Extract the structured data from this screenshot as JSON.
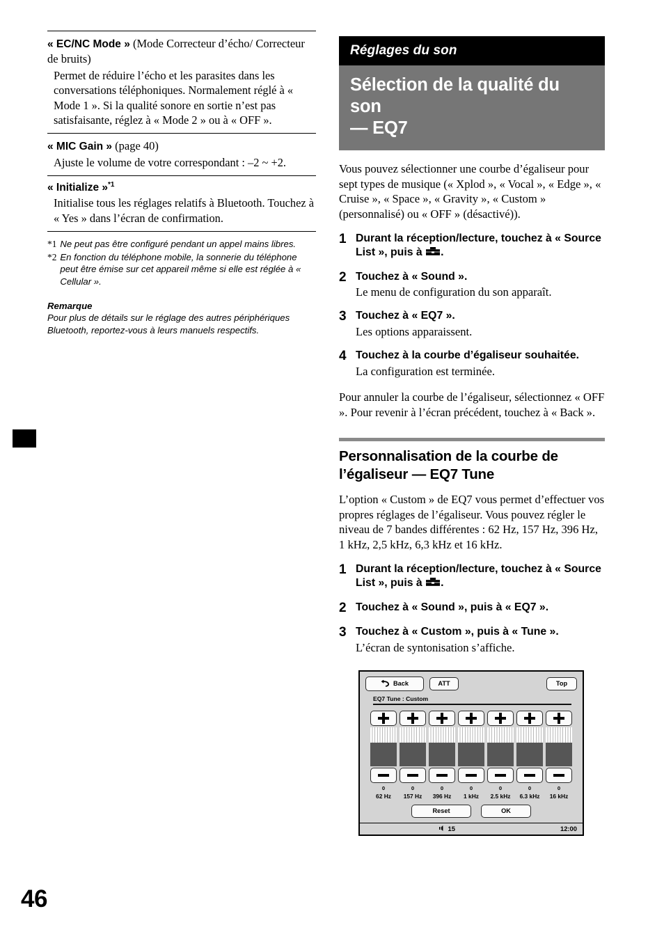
{
  "page": {
    "folio": "46"
  },
  "left_column": {
    "items": [
      {
        "title_bold": "« EC/NC Mode »",
        "title_rest": " (Mode Correcteur d’écho/ Correcteur de bruits)",
        "body": "Permet de réduire l’écho et les parasites dans les conversations téléphoniques. Normalement réglé à « Mode 1 ». Si la qualité sonore en sortie n’est pas satisfaisante, réglez à « Mode 2 » ou à « OFF »."
      },
      {
        "title_bold": "« MIC Gain »",
        "title_rest": " (page 40)",
        "body": "Ajuste le volume de votre correspondant : –2 ~ +2."
      },
      {
        "title_bold": "« Initialize »",
        "title_footnote": "*1",
        "title_rest": "",
        "body": "Initialise tous les réglages relatifs à Bluetooth. Touchez à « Yes » dans l’écran de confirmation."
      }
    ],
    "footnotes": [
      {
        "mark": "*1",
        "text": "Ne peut pas être configuré pendant un appel mains libres."
      },
      {
        "mark": "*2",
        "text": "En fonction du téléphone mobile, la sonnerie du téléphone peut être émise sur cet appareil même si elle est réglée à « Cellular »."
      }
    ],
    "remark": {
      "title": "Remarque",
      "text": "Pour plus de détails sur le réglage des autres périphériques Bluetooth, reportez-vous à leurs manuels respectifs."
    }
  },
  "right_column": {
    "banner_black": "Réglages du son",
    "banner_gray_line1": "Sélection de la qualité du son",
    "banner_gray_line2": "— EQ7",
    "intro": "Vous pouvez sélectionner une courbe d’égaliseur pour sept types de musique (« Xplod », « Vocal », « Edge », « Cruise », « Space », « Gravity », « Custom » (personnalisé) ou « OFF » (désactivé)).",
    "steps_1": [
      {
        "num": "1",
        "title_a": "Durant la réception/lecture, touchez à « Source List », puis à ",
        "icon": "toolbox-icon",
        "title_b": ".",
        "sub": ""
      },
      {
        "num": "2",
        "title_a": "Touchez à « Sound ».",
        "sub": "Le menu de configuration du son apparaît."
      },
      {
        "num": "3",
        "title_a": "Touchez à « EQ7 ».",
        "sub": "Les options apparaissent."
      },
      {
        "num": "4",
        "title_a": "Touchez à la courbe d’égaliseur souhaitée.",
        "sub": "La configuration est terminée."
      }
    ],
    "after_steps": "Pour annuler la courbe de l’égaliseur, sélectionnez « OFF ». Pour revenir à l’écran précédent, touchez à « Back ».",
    "section_heading": "Personnalisation de la courbe de l’égaliseur — EQ7 Tune",
    "section_intro": "L’option « Custom » de EQ7 vous permet d’effectuer vos propres réglages de l’égaliseur. Vous pouvez régler le niveau de 7 bandes différentes : 62 Hz, 157 Hz, 396 Hz, 1 kHz, 2,5 kHz, 6,3 kHz et 16 kHz.",
    "steps_2": [
      {
        "num": "1",
        "title_a": "Durant la réception/lecture, touchez à « Source List », puis à ",
        "icon": "toolbox-icon",
        "title_b": ".",
        "sub": ""
      },
      {
        "num": "2",
        "title_a": "Touchez à « Sound », puis à « EQ7 ».",
        "sub": ""
      },
      {
        "num": "3",
        "title_a": "Touchez à « Custom », puis à « Tune ».",
        "sub": "L’écran de syntonisation s’affiche."
      }
    ]
  },
  "device_screen": {
    "back_label": "Back",
    "att_label": "ATT",
    "top_label": "Top",
    "subtitle": "EQ7 Tune : Custom",
    "bands": [
      {
        "value": "0",
        "freq": "62 Hz"
      },
      {
        "value": "0",
        "freq": "157 Hz"
      },
      {
        "value": "0",
        "freq": "396 Hz"
      },
      {
        "value": "0",
        "freq": "1 kHz"
      },
      {
        "value": "0",
        "freq": "2.5 kHz"
      },
      {
        "value": "0",
        "freq": "6.3 kHz"
      },
      {
        "value": "0",
        "freq": "16 kHz"
      }
    ],
    "reset_label": "Reset",
    "ok_label": "OK",
    "volume": "15",
    "clock": "12:00",
    "colors": {
      "screen_bg": "#d4d4d4",
      "band_fill": "#565656",
      "button_bg": "#fbfbfb"
    }
  }
}
